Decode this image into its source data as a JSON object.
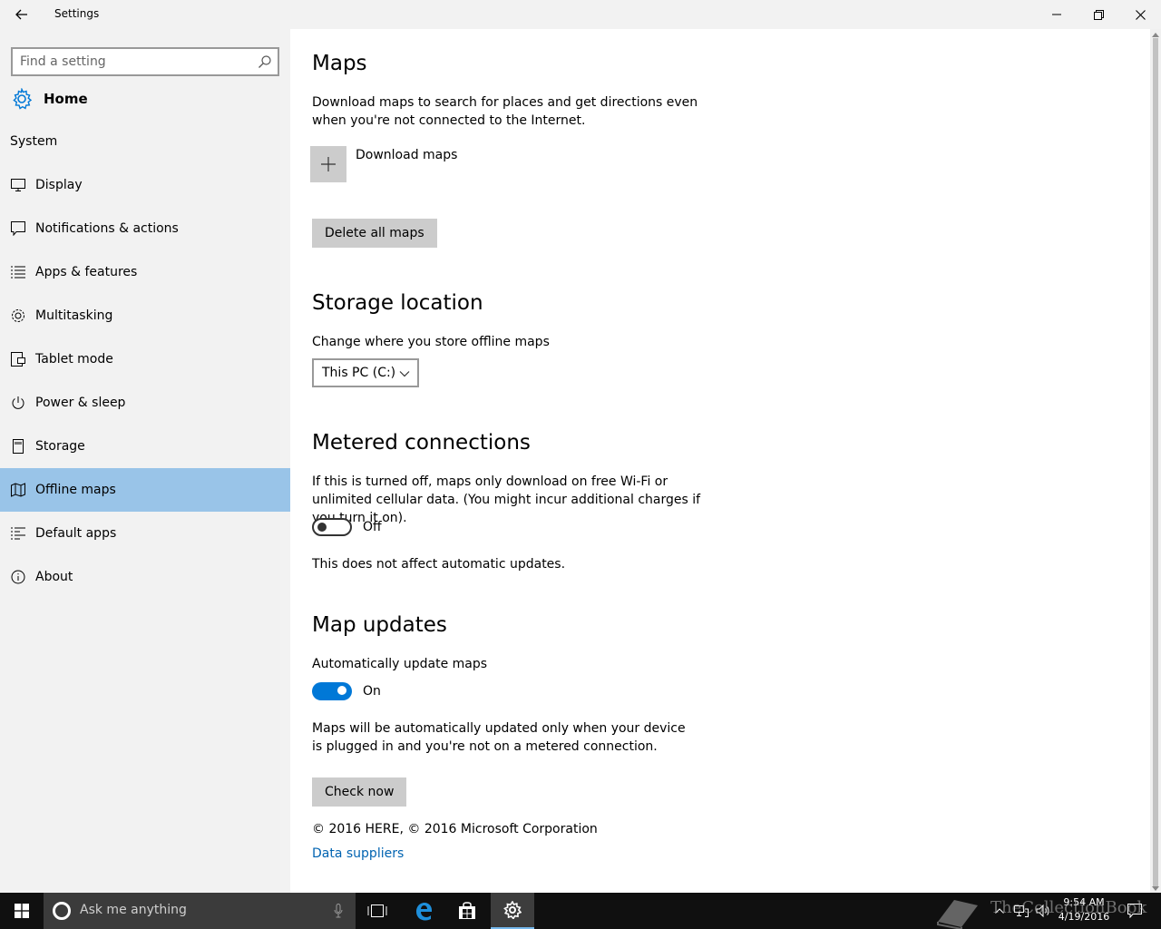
{
  "window": {
    "title": "Settings"
  },
  "sidebar": {
    "search_placeholder": "Find a setting",
    "home_label": "Home",
    "section_label": "System",
    "items": [
      {
        "label": "Display",
        "icon": "monitor-icon"
      },
      {
        "label": "Notifications & actions",
        "icon": "notification-icon"
      },
      {
        "label": "Apps & features",
        "icon": "list-icon"
      },
      {
        "label": "Multitasking",
        "icon": "multitasking-icon"
      },
      {
        "label": "Tablet mode",
        "icon": "tablet-icon"
      },
      {
        "label": "Power & sleep",
        "icon": "power-icon"
      },
      {
        "label": "Storage",
        "icon": "storage-icon"
      },
      {
        "label": "Offline maps",
        "icon": "map-icon",
        "selected": true
      },
      {
        "label": "Default apps",
        "icon": "default-apps-icon"
      },
      {
        "label": "About",
        "icon": "info-icon"
      }
    ]
  },
  "content": {
    "maps": {
      "title": "Maps",
      "description": "Download maps to search for places and get directions even when you're not connected to the Internet.",
      "download_label": "Download maps",
      "delete_button": "Delete all maps"
    },
    "storage": {
      "title": "Storage location",
      "description": "Change where you store offline maps",
      "selected_location": "This PC (C:)"
    },
    "metered": {
      "title": "Metered connections",
      "description": "If this is turned off, maps only download on free Wi-Fi or unlimited cellular data. (You might incur additional charges if you turn it on).",
      "toggle_state": "Off",
      "note": "This does not affect automatic updates."
    },
    "updates": {
      "title": "Map updates",
      "description": "Automatically update maps",
      "toggle_state": "On",
      "note": "Maps will be automatically updated only when your device is plugged in and you're not on a metered connection.",
      "check_button": "Check now"
    },
    "copyright": "© 2016 HERE, © 2016 Microsoft Corporation",
    "data_suppliers_link": "Data suppliers"
  },
  "taskbar": {
    "search_placeholder": "Ask me anything",
    "time": "9:54 AM",
    "date": "4/19/2016",
    "accent_color": "#76b9ed"
  },
  "watermark": {
    "text": "TheCollectionBook"
  },
  "colors": {
    "selected_nav": "#99c4e8",
    "toggle_on": "#0078d7",
    "link": "#0063b1",
    "accent": "#0078d7"
  }
}
